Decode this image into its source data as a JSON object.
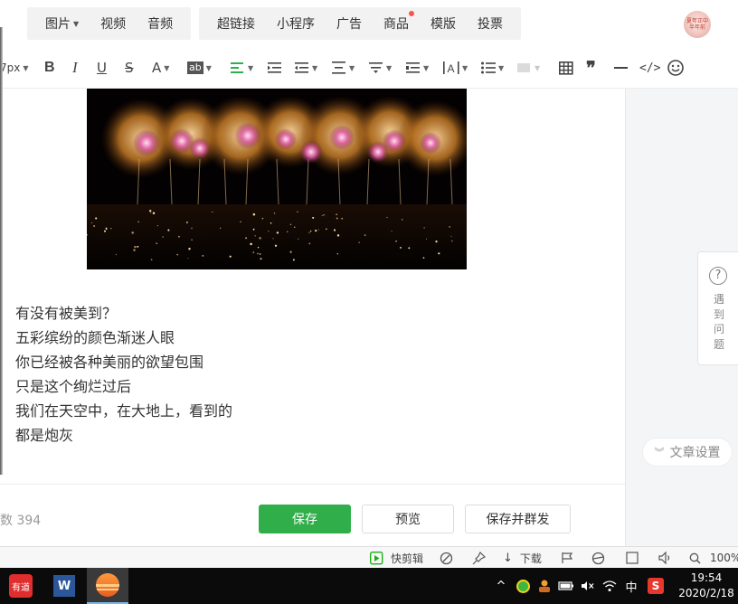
{
  "insert_toolbar": {
    "group1": [
      {
        "label": "图片",
        "has_caret": true
      },
      {
        "label": "视频"
      },
      {
        "label": "音频"
      }
    ],
    "group2": [
      {
        "label": "超链接"
      },
      {
        "label": "小程序"
      },
      {
        "label": "广告"
      },
      {
        "label": "商品",
        "has_dot": true
      },
      {
        "label": "模版"
      },
      {
        "label": "投票"
      }
    ],
    "avatar_text": "夏年正中 半年前"
  },
  "format_toolbar": {
    "font_size": "7px",
    "items": [
      "bold-icon",
      "italic-icon",
      "underline-icon",
      "strikethrough-icon",
      "font-color-icon",
      "highlight-icon",
      "align-left-icon",
      "indent-icon",
      "first-line-indent-icon",
      "line-height-icon",
      "paragraph-spacing-icon",
      "margin-icon",
      "letter-spacing-icon",
      "unordered-list-icon",
      "border-icon",
      "table-icon",
      "quote-icon",
      "divider-icon",
      "code-icon",
      "emoji-icon"
    ],
    "highlight_label": "ab",
    "accent_color": "#2fae4a"
  },
  "editor": {
    "image_alt": "fireworks",
    "lines": [
      "有没有被美到？",
      "五彩缤纷的颜色渐迷人眼",
      "你已经被各种美丽的欲望包围",
      "只是这个绚烂过后",
      "我们在天空中，在大地上，看到的",
      "都是炮灰"
    ]
  },
  "side": {
    "help_label": "遇到问题",
    "help_chars": [
      "遇",
      "到",
      "问",
      "题"
    ],
    "article_settings": "文章设置"
  },
  "bottom": {
    "word_count": "数 394",
    "save": "保存",
    "preview": "预览",
    "save_and_send": "保存并群发"
  },
  "status_bar": {
    "quick_edit": "快剪辑",
    "download": "下载",
    "zoom": "100%"
  },
  "taskbar": {
    "apps": [
      "youdao-dict",
      "word",
      "browser"
    ],
    "youdao_label": "有道",
    "word_label": "W",
    "ime": "中",
    "time": "19:54",
    "date": "2020/2/18"
  }
}
